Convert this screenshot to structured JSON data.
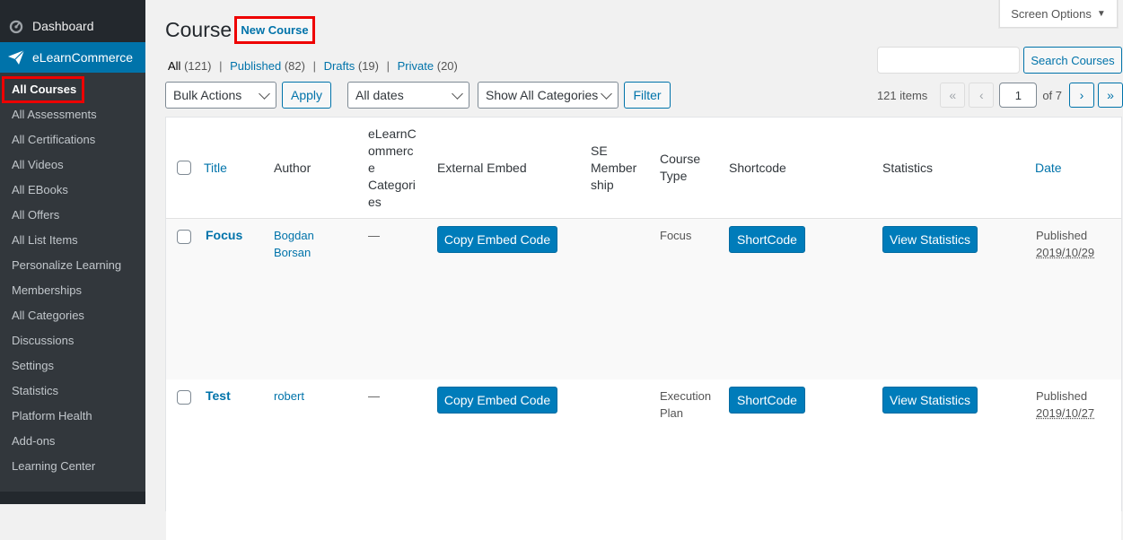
{
  "sidebar": {
    "dashboard_label": "Dashboard",
    "plugin_label": "eLearnCommerce",
    "items": [
      {
        "label": "All Courses"
      },
      {
        "label": "All Assessments"
      },
      {
        "label": "All Certifications"
      },
      {
        "label": "All Videos"
      },
      {
        "label": "All EBooks"
      },
      {
        "label": "All Offers"
      },
      {
        "label": "All List Items"
      },
      {
        "label": "Personalize Learning"
      },
      {
        "label": "Memberships"
      },
      {
        "label": "All Categories"
      },
      {
        "label": "Discussions"
      },
      {
        "label": "Settings"
      },
      {
        "label": "Statistics"
      },
      {
        "label": "Platform Health"
      },
      {
        "label": "Add-ons"
      },
      {
        "label": "Learning Center"
      }
    ]
  },
  "header": {
    "screen_options": "Screen Options",
    "title": "Course",
    "new_button": "New Course"
  },
  "views": {
    "all": "All",
    "all_count": "(121)",
    "published": "Published",
    "published_count": "(82)",
    "drafts": "Drafts",
    "drafts_count": "(19)",
    "private": "Private",
    "private_count": "(20)",
    "separator": "|"
  },
  "search": {
    "button": "Search Courses",
    "value": ""
  },
  "filters": {
    "bulk_actions": "Bulk Actions",
    "apply": "Apply",
    "dates": "All dates",
    "categories": "Show All Categories",
    "filter": "Filter"
  },
  "pagination": {
    "items": "121 items",
    "first": "«",
    "prev": "‹",
    "current": "1",
    "of": "of 7",
    "next": "›",
    "last": "»"
  },
  "table": {
    "columns": {
      "title": "Title",
      "author": "Author",
      "categories": "eLearnC ommerc e Categori es",
      "embed": "External Embed",
      "membership": "SE Member ship",
      "type": "Course Type",
      "shortcode": "Shortcode",
      "statistics": "Statistics",
      "date": "Date"
    },
    "col_lines": {
      "categories": [
        "eLearnC",
        "ommerc",
        "e",
        "Categori",
        "es"
      ],
      "membership": [
        "SE",
        "Member",
        "ship"
      ],
      "type": [
        "Course",
        "Type"
      ]
    },
    "rows": [
      {
        "title": "Focus",
        "author_lines": [
          "Bogdan",
          "Borsan"
        ],
        "categories": "—",
        "embed_button": "Copy Embed Code",
        "type_lines": [
          "Focus"
        ],
        "shortcode_button": "ShortCode",
        "stats_button": "View Statistics",
        "status": "Published",
        "date": "2019/10/29"
      },
      {
        "title": "Test",
        "author_lines": [
          "robert"
        ],
        "categories": "—",
        "embed_button": "Copy Embed Code",
        "type_lines": [
          "Execution",
          "Plan"
        ],
        "shortcode_button": "ShortCode",
        "stats_button": "View Statistics",
        "status": "Published",
        "date": "2019/10/27"
      }
    ]
  },
  "colors": {
    "sidebar_bg": "#23282d",
    "submenu_bg": "#32373c",
    "accent": "#0073aa",
    "primary_button": "#007cba",
    "highlight_box": "#e00000"
  }
}
